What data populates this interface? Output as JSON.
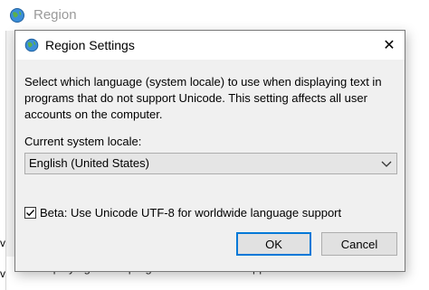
{
  "background_window": {
    "title": "Region",
    "edge_char_1": "v",
    "edge_char_2": "v",
    "bottom_text": "displaying text in programs that do not support Unicode."
  },
  "dialog": {
    "title": "Region Settings",
    "close_glyph": "✕",
    "description": "Select which language (system locale) to use when displaying text in programs that do not support Unicode. This setting affects all user accounts on the computer.",
    "locale_label": "Current system locale:",
    "locale_value": "English (United States)",
    "beta_label": "Beta: Use Unicode UTF-8 for worldwide language support",
    "beta_checked": true,
    "ok_label": "OK",
    "cancel_label": "Cancel"
  },
  "colors": {
    "accent": "#0078d7",
    "dialog_bg": "#f0f0f0",
    "button_bg": "#e1e1e1"
  },
  "icons": [
    "globe-icon",
    "close-icon",
    "chevron-down-icon",
    "checkmark-icon"
  ]
}
